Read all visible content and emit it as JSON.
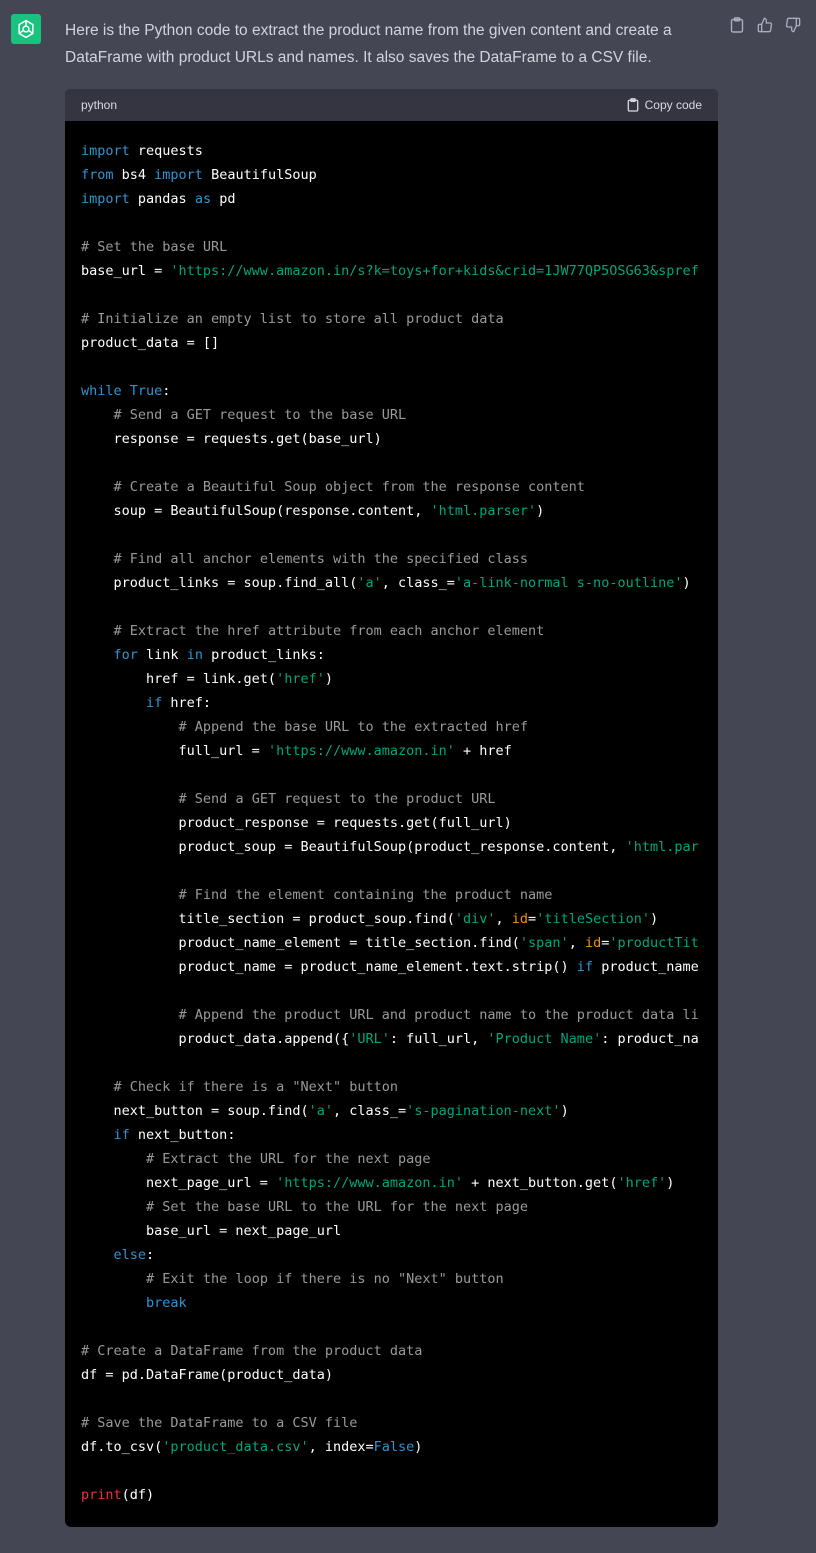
{
  "message": {
    "text": "Here is the Python code to extract the product name from the given content and create a DataFrame with product URLs and names. It also saves the DataFrame to a CSV file."
  },
  "code_block": {
    "language": "python",
    "copy_label": "Copy code",
    "lines": [
      [
        {
          "t": "import",
          "c": "kw"
        },
        {
          "t": " requests"
        }
      ],
      [
        {
          "t": "from",
          "c": "kw"
        },
        {
          "t": " bs4 "
        },
        {
          "t": "import",
          "c": "kw"
        },
        {
          "t": " BeautifulSoup"
        }
      ],
      [
        {
          "t": "import",
          "c": "kw"
        },
        {
          "t": " pandas "
        },
        {
          "t": "as",
          "c": "kw"
        },
        {
          "t": " pd"
        }
      ],
      [],
      [
        {
          "t": "# Set the base URL",
          "c": "com"
        }
      ],
      [
        {
          "t": "base_url = "
        },
        {
          "t": "'https://www.amazon.in/s?k=toys+for+kids&crid=1JW77QP5OSG63&spref",
          "c": "str"
        }
      ],
      [],
      [
        {
          "t": "# Initialize an empty list to store all product data",
          "c": "com"
        }
      ],
      [
        {
          "t": "product_data = []"
        }
      ],
      [],
      [
        {
          "t": "while",
          "c": "kw"
        },
        {
          "t": " "
        },
        {
          "t": "True",
          "c": "kw"
        },
        {
          "t": ":"
        }
      ],
      [
        {
          "t": "    "
        },
        {
          "t": "# Send a GET request to the base URL",
          "c": "com"
        }
      ],
      [
        {
          "t": "    response = requests.get(base_url)"
        }
      ],
      [],
      [
        {
          "t": "    "
        },
        {
          "t": "# Create a Beautiful Soup object from the response content",
          "c": "com"
        }
      ],
      [
        {
          "t": "    soup = BeautifulSoup(response.content, "
        },
        {
          "t": "'html.parser'",
          "c": "str"
        },
        {
          "t": ")"
        }
      ],
      [],
      [
        {
          "t": "    "
        },
        {
          "t": "# Find all anchor elements with the specified class",
          "c": "com"
        }
      ],
      [
        {
          "t": "    product_links = soup.find_all("
        },
        {
          "t": "'a'",
          "c": "str"
        },
        {
          "t": ", class_="
        },
        {
          "t": "'a-link-normal s-no-outline'",
          "c": "str"
        },
        {
          "t": ")"
        }
      ],
      [],
      [
        {
          "t": "    "
        },
        {
          "t": "# Extract the href attribute from each anchor element",
          "c": "com"
        }
      ],
      [
        {
          "t": "    "
        },
        {
          "t": "for",
          "c": "kw"
        },
        {
          "t": " link "
        },
        {
          "t": "in",
          "c": "kw"
        },
        {
          "t": " product_links:"
        }
      ],
      [
        {
          "t": "        href = link.get("
        },
        {
          "t": "'href'",
          "c": "str"
        },
        {
          "t": ")"
        }
      ],
      [
        {
          "t": "        "
        },
        {
          "t": "if",
          "c": "kw"
        },
        {
          "t": " href:"
        }
      ],
      [
        {
          "t": "            "
        },
        {
          "t": "# Append the base URL to the extracted href",
          "c": "com"
        }
      ],
      [
        {
          "t": "            full_url = "
        },
        {
          "t": "'https://www.amazon.in'",
          "c": "str"
        },
        {
          "t": " + href"
        }
      ],
      [],
      [
        {
          "t": "            "
        },
        {
          "t": "# Send a GET request to the product URL",
          "c": "com"
        }
      ],
      [
        {
          "t": "            product_response = requests.get(full_url)"
        }
      ],
      [
        {
          "t": "            product_soup = BeautifulSoup(product_response.content, "
        },
        {
          "t": "'html.par",
          "c": "str"
        }
      ],
      [],
      [
        {
          "t": "            "
        },
        {
          "t": "# Find the element containing the product name",
          "c": "com"
        }
      ],
      [
        {
          "t": "            title_section = product_soup.find("
        },
        {
          "t": "'div'",
          "c": "str"
        },
        {
          "t": ", "
        },
        {
          "t": "id",
          "c": "bi"
        },
        {
          "t": "="
        },
        {
          "t": "'titleSection'",
          "c": "str"
        },
        {
          "t": ")"
        }
      ],
      [
        {
          "t": "            product_name_element = title_section.find("
        },
        {
          "t": "'span'",
          "c": "str"
        },
        {
          "t": ", "
        },
        {
          "t": "id",
          "c": "bi"
        },
        {
          "t": "="
        },
        {
          "t": "'productTit",
          "c": "str"
        }
      ],
      [
        {
          "t": "            product_name = product_name_element.text.strip() "
        },
        {
          "t": "if",
          "c": "kw"
        },
        {
          "t": " product_name"
        }
      ],
      [],
      [
        {
          "t": "            "
        },
        {
          "t": "# Append the product URL and product name to the product data li",
          "c": "com"
        }
      ],
      [
        {
          "t": "            product_data.append({"
        },
        {
          "t": "'URL'",
          "c": "str"
        },
        {
          "t": ": full_url, "
        },
        {
          "t": "'Product Name'",
          "c": "str"
        },
        {
          "t": ": product_na"
        }
      ],
      [],
      [
        {
          "t": "    "
        },
        {
          "t": "# Check if there is a \"Next\" button",
          "c": "com"
        }
      ],
      [
        {
          "t": "    next_button = soup.find("
        },
        {
          "t": "'a'",
          "c": "str"
        },
        {
          "t": ", class_="
        },
        {
          "t": "'s-pagination-next'",
          "c": "str"
        },
        {
          "t": ")"
        }
      ],
      [
        {
          "t": "    "
        },
        {
          "t": "if",
          "c": "kw"
        },
        {
          "t": " next_button:"
        }
      ],
      [
        {
          "t": "        "
        },
        {
          "t": "# Extract the URL for the next page",
          "c": "com"
        }
      ],
      [
        {
          "t": "        next_page_url = "
        },
        {
          "t": "'https://www.amazon.in'",
          "c": "str"
        },
        {
          "t": " + next_button.get("
        },
        {
          "t": "'href'",
          "c": "str"
        },
        {
          "t": ")"
        }
      ],
      [
        {
          "t": "        "
        },
        {
          "t": "# Set the base URL to the URL for the next page",
          "c": "com"
        }
      ],
      [
        {
          "t": "        base_url = next_page_url"
        }
      ],
      [
        {
          "t": "    "
        },
        {
          "t": "else",
          "c": "kw"
        },
        {
          "t": ":"
        }
      ],
      [
        {
          "t": "        "
        },
        {
          "t": "# Exit the loop if there is no \"Next\" button",
          "c": "com"
        }
      ],
      [
        {
          "t": "        "
        },
        {
          "t": "break",
          "c": "kw"
        }
      ],
      [],
      [
        {
          "t": "# Create a DataFrame from the product data",
          "c": "com"
        }
      ],
      [
        {
          "t": "df = pd.DataFrame(product_data)"
        }
      ],
      [],
      [
        {
          "t": "# Save the DataFrame to a CSV file",
          "c": "com"
        }
      ],
      [
        {
          "t": "df.to_csv("
        },
        {
          "t": "'product_data.csv'",
          "c": "str"
        },
        {
          "t": ", index="
        },
        {
          "t": "False",
          "c": "kw"
        },
        {
          "t": ")"
        }
      ],
      [],
      [
        {
          "t": "print",
          "c": "fn"
        },
        {
          "t": "(df)"
        }
      ]
    ]
  },
  "icons": {
    "avatar": "openai-logo-icon",
    "copy": "clipboard-icon",
    "like": "thumbs-up-icon",
    "dislike": "thumbs-down-icon"
  },
  "colors": {
    "background": "#444654",
    "avatar": "#19c37d",
    "code_background": "#000000",
    "code_header": "#343541",
    "keyword": "#2e95d3",
    "string": "#00a67d",
    "comment": "#9a9a9a"
  }
}
